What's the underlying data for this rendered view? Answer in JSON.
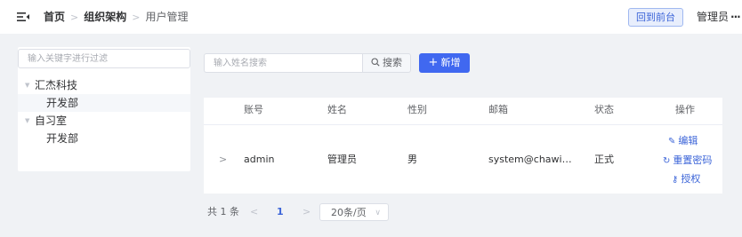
{
  "header": {
    "menu_icon": "menu-fold-icon",
    "breadcrumb": [
      "首页",
      "组织架构",
      "用户管理"
    ],
    "front_button": "回到前台",
    "user_name": "管理员",
    "more_icon": "more-dots-icon"
  },
  "tree": {
    "filter_placeholder": "输入关键字进行过滤",
    "nodes": [
      "汇杰科技",
      "开发部",
      "自习室",
      "开发部"
    ]
  },
  "search": {
    "placeholder": "输入姓名搜索",
    "search_label": "搜索",
    "add_label": "新增"
  },
  "table": {
    "columns": [
      "账号",
      "姓名",
      "性别",
      "邮箱",
      "状态",
      "操作"
    ],
    "rows": [
      {
        "account": "admin",
        "name": "管理员",
        "gender": "男",
        "email": "system@chawi…",
        "status": "正式",
        "actions": [
          "编辑",
          "重置密码",
          "授权"
        ]
      }
    ]
  },
  "pagination": {
    "total": "共 1 条",
    "current_page": "1",
    "page_size": "20条/页"
  },
  "colors": {
    "primary": "#4068f0",
    "link": "#3b64d8",
    "background": "#f0f2f5"
  }
}
